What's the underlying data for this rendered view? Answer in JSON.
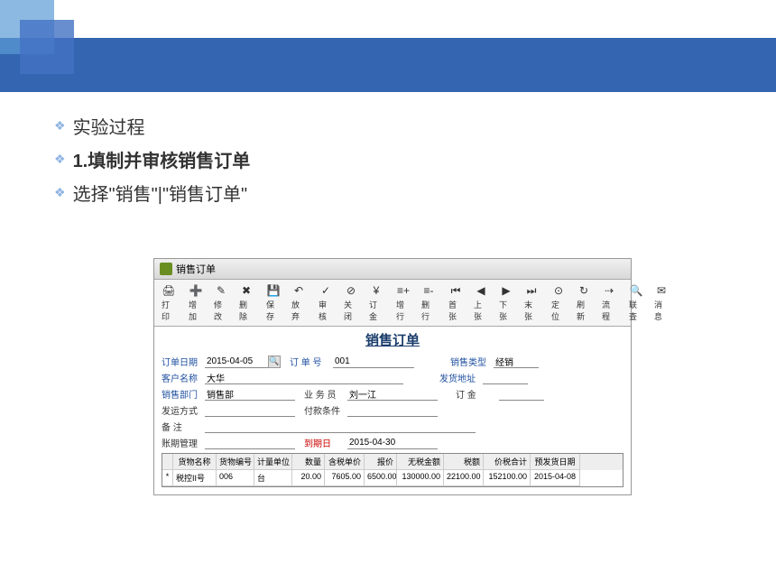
{
  "bullets": {
    "b1": "实验过程",
    "b2": "1.填制并审核销售订单",
    "b3": "选择\"销售\"|\"销售订单\""
  },
  "window": {
    "title": "销售订单",
    "form_title": "销售订单"
  },
  "toolbar": [
    {
      "label": "打印",
      "icon": "🖨"
    },
    {
      "label": "增加",
      "icon": "➕"
    },
    {
      "label": "修改",
      "icon": "✎"
    },
    {
      "label": "删除",
      "icon": "✖"
    },
    {
      "label": "保存",
      "icon": "💾"
    },
    {
      "label": "放弃",
      "icon": "↶"
    },
    {
      "label": "审核",
      "icon": "✓"
    },
    {
      "label": "关闭",
      "icon": "⊘"
    },
    {
      "label": "订金",
      "icon": "¥"
    },
    {
      "label": "增行",
      "icon": "≡+"
    },
    {
      "label": "删行",
      "icon": "≡-"
    },
    {
      "label": "首张",
      "icon": "⏮"
    },
    {
      "label": "上张",
      "icon": "◀"
    },
    {
      "label": "下张",
      "icon": "▶"
    },
    {
      "label": "末张",
      "icon": "⏭"
    },
    {
      "label": "定位",
      "icon": "⊙"
    },
    {
      "label": "刷新",
      "icon": "↻"
    },
    {
      "label": "流程",
      "icon": "⇢"
    },
    {
      "label": "联查",
      "icon": "🔍"
    },
    {
      "label": "消息",
      "icon": "✉"
    }
  ],
  "form": {
    "order_date_label": "订单日期",
    "order_date": "2015-04-05",
    "order_no_label": "订 单 号",
    "order_no": "001",
    "sale_type_label": "销售类型",
    "sale_type": "经销",
    "customer_label": "客户名称",
    "customer": "大华",
    "ship_addr_label": "发货地址",
    "ship_addr": "",
    "dept_label": "销售部门",
    "dept": "销售部",
    "salesman_label": "业 务 员",
    "salesman": "刘一江",
    "deposit_label": "订   金",
    "deposit": "",
    "ship_method_label": "发运方式",
    "ship_method": "",
    "pay_term_label": "付款条件",
    "pay_term": "",
    "remark_label": "备   注",
    "remark": "",
    "credit_label": "账期管理",
    "credit": "",
    "due_date_label": "到期日",
    "due_date": "2015-04-30"
  },
  "grid": {
    "headers": {
      "name": "货物名称",
      "code": "货物编号",
      "unit": "计量单位",
      "qty": "数量",
      "price": "含税单价",
      "quote": "报价",
      "notax": "无税金额",
      "tax": "税额",
      "total": "价税合计",
      "ship": "预发货日期"
    },
    "row": {
      "mark": "*",
      "name": "税控II号",
      "code": "006",
      "unit": "台",
      "qty": "20.00",
      "price": "7605.00",
      "quote": "6500.00",
      "notax": "130000.00",
      "tax": "22100.00",
      "total": "152100.00",
      "ship": "2015-04-08"
    }
  }
}
